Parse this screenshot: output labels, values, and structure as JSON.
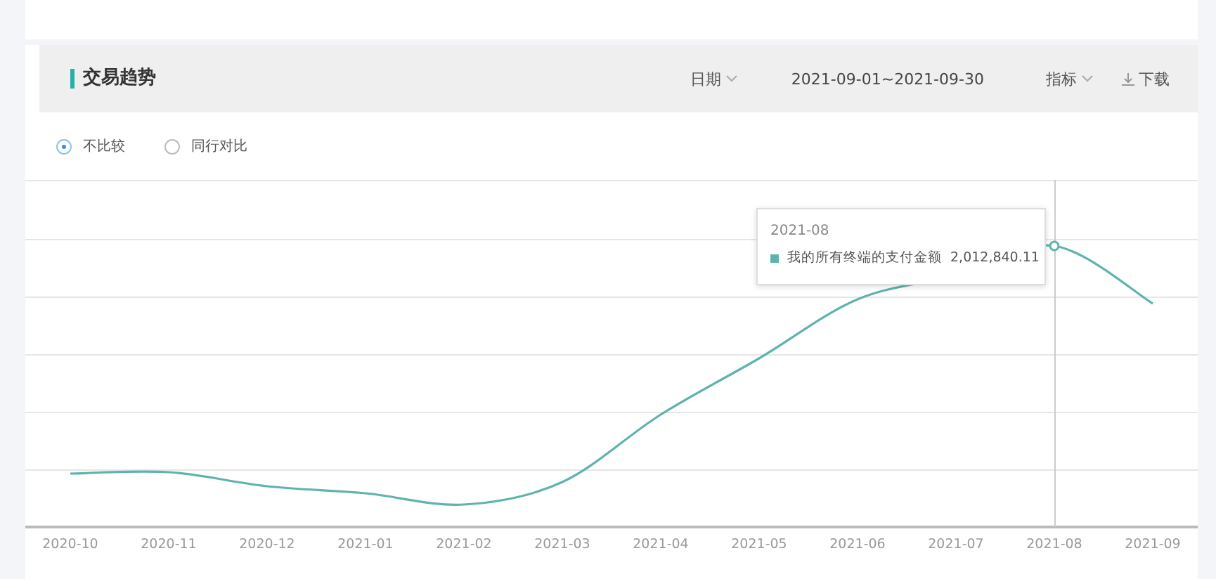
{
  "section": {
    "title": "交易趋势"
  },
  "toolbar": {
    "date_label": "日期",
    "date_range": "2021-09-01~2021-09-30",
    "metric_label": "指标",
    "download_label": "下载"
  },
  "compare_options": [
    {
      "label": "不比较",
      "selected": true
    },
    {
      "label": "同行对比",
      "selected": false
    }
  ],
  "chart": {
    "x_labels": [
      "2020-10",
      "2020-11",
      "2020-12",
      "2021-01",
      "2021-02",
      "2021-03",
      "2021-04",
      "2021-05",
      "2021-06",
      "2021-07",
      "2021-08",
      "2021-09"
    ],
    "tooltip": {
      "title": "2021-08",
      "series_name": "我的所有终端的支付金额",
      "value": "2,012,840.11",
      "color": "#5fb3ad"
    }
  }
}
